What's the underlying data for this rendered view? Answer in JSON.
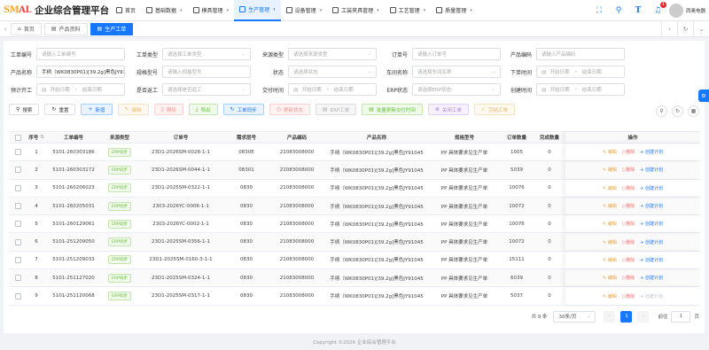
{
  "app": {
    "logo_mark_a": "SM",
    "logo_mark_b": "AL",
    "title": "企业综合管理平台"
  },
  "nav": [
    {
      "label": "首页",
      "icon": "home-icon",
      "chevron": false,
      "active": false
    },
    {
      "label": "基础数据",
      "icon": "grid-icon",
      "chevron": true,
      "active": false
    },
    {
      "label": "模具管理",
      "icon": "mold-icon",
      "chevron": true,
      "active": false
    },
    {
      "label": "生产管理",
      "icon": "factory-icon",
      "chevron": true,
      "active": true
    },
    {
      "label": "设备管理",
      "icon": "device-icon",
      "chevron": true,
      "active": false
    },
    {
      "label": "工装夹具管理",
      "icon": "tool-icon",
      "chevron": true,
      "active": false
    },
    {
      "label": "工艺管理",
      "icon": "process-icon",
      "chevron": true,
      "active": false
    },
    {
      "label": "质量管理",
      "icon": "quality-icon",
      "chevron": true,
      "active": false
    }
  ],
  "top_right": {
    "notification_count": "1",
    "username": "西奥电器"
  },
  "tabs": [
    {
      "label": "首页",
      "active": false
    },
    {
      "label": "产品资料",
      "active": false
    },
    {
      "label": "生产工单",
      "active": true
    }
  ],
  "filters": {
    "work_order_no": {
      "label": "工单编号",
      "placeholder": "请输入工单编号"
    },
    "work_order_type": {
      "label": "工单类型",
      "placeholder": "请选择工单类型"
    },
    "source_type": {
      "label": "来源类型",
      "placeholder": "请选择来源类型"
    },
    "order_no": {
      "label": "订单号",
      "placeholder": "请输入订单号"
    },
    "product_code": {
      "label": "产品编码",
      "placeholder": "请输入产品编码"
    },
    "product_name": {
      "label": "产品名称",
      "value": "手柄（WK0830P01)[39.2g]黑色JY91"
    },
    "spec_model": {
      "label": "规格型号",
      "placeholder": "请输入规格型号"
    },
    "status": {
      "label": "状态",
      "placeholder": "请选择状态"
    },
    "workshop_name": {
      "label": "车间名称",
      "placeholder": "请选择车间名称"
    },
    "order_time": {
      "label": "下单时间",
      "start": "开始日期",
      "end": "结束日期"
    },
    "planned_start": {
      "label": "预计开工",
      "start": "开始日期",
      "end": "结束日期"
    },
    "is_outsourced": {
      "label": "是否返工",
      "placeholder": "请选择是否返工"
    },
    "delivery_time": {
      "label": "交付时间",
      "start": "开始日期",
      "end": "结束日期"
    },
    "erp_status": {
      "label": "ERP状态",
      "placeholder": "请选择ERP状态"
    },
    "create_time": {
      "label": "创建时间",
      "start": "开始日期",
      "end": "结束日期"
    }
  },
  "toolbar": {
    "search": "搜索",
    "reset": "重置",
    "add": "新增",
    "edit": "编辑",
    "delete": "删除",
    "export": "导出",
    "sync": "工单同步",
    "deliver": "更新状态",
    "erp": "ERP工单",
    "batch_update": "批量更新交付时间",
    "close": "关闭工单",
    "finish": "完结工单"
  },
  "table": {
    "headers": [
      "序号",
      "工单编号",
      "来源类型",
      "订单号",
      "需求层号",
      "产品编码",
      "产品名称",
      "规格型号",
      "订单数量",
      "完成数量",
      "操作"
    ],
    "sort_icon": "⇅",
    "op_edit": "编辑",
    "op_delete": "删除",
    "op_plan": "+ 创建计划",
    "rows": [
      {
        "no": "1",
        "code": "5101-260303186",
        "source": "ERP同步",
        "order": "23D1-2026SM-0028-1-1",
        "req": "0830E",
        "pcode": "21083008000",
        "pname": "手柄（WK0830P01)[39.2g]黑色JY91045",
        "spec": "PP 具体要求见生产单",
        "qty": "1005",
        "done": "0",
        "plan_disabled": false
      },
      {
        "no": "2",
        "code": "5101-260303172",
        "source": "ERP同步",
        "order": "23D1-2026SM-0044-1-1",
        "req": "08301",
        "pcode": "21083008000",
        "pname": "手柄（WK0830P01)[39.2g]黑色JY91045",
        "spec": "PP 具体要求见生产单",
        "qty": "5039",
        "done": "0",
        "plan_disabled": false
      },
      {
        "no": "3",
        "code": "5101-260206023",
        "source": "ERP同步",
        "order": "23D1-2025SM-0322-1-1",
        "req": "0830",
        "pcode": "21083008000",
        "pname": "手柄（WK0830P01)[39.2g]黑色JY91045",
        "spec": "PP 具体要求见生产单",
        "qty": "10076",
        "done": "0",
        "plan_disabled": false
      },
      {
        "no": "4",
        "code": "5101-260205031",
        "source": "ERP同步",
        "order": "2303-2026YC-0006-1-1",
        "req": "0830",
        "pcode": "21083008000",
        "pname": "手柄（WK0830P01)[39.2g]黑色JY91045",
        "spec": "PP 具体要求见生产单",
        "qty": "10072",
        "done": "0",
        "plan_disabled": false
      },
      {
        "no": "5",
        "code": "5101-260129061",
        "source": "ERP同步",
        "order": "2303-2026YC-0002-1-1",
        "req": "0830",
        "pcode": "21083008000",
        "pname": "手柄（WK0830P01)[39.2g]黑色JY91045",
        "spec": "PP 具体要求见生产单",
        "qty": "10076",
        "done": "0",
        "plan_disabled": false
      },
      {
        "no": "6",
        "code": "5101-251209050",
        "source": "ERP同步",
        "order": "23D1-2025SM-0356-1-1",
        "req": "0830",
        "pcode": "21083008000",
        "pname": "手柄（WK0830P01)[39.2g]黑色JY91045",
        "spec": "PP 具体要求见生产单",
        "qty": "10072",
        "done": "0",
        "plan_disabled": false
      },
      {
        "no": "7",
        "code": "5101-251209033",
        "source": "ERP同步",
        "order": "23D1-2025SM-0160-3-1-1",
        "req": "0830",
        "pcode": "21083008000",
        "pname": "手柄（WK0830P01)[39.2g]黑色JY91045",
        "spec": "PP 具体要求见生产单",
        "qty": "15111",
        "done": "0",
        "plan_disabled": false
      },
      {
        "no": "8",
        "code": "5101-251127020",
        "source": "ERP同步",
        "order": "23D1-2025SM-0324-1-1",
        "req": "0830",
        "pcode": "21083008000",
        "pname": "手柄（WK0830P01)[39.2g]黑色JY91045",
        "spec": "PP 具体要求见生产单",
        "qty": "6039",
        "done": "0",
        "plan_disabled": false
      },
      {
        "no": "9",
        "code": "5101-251120068",
        "source": "ERP同步",
        "order": "23D1-2025SM-0317-1-1",
        "req": "0830",
        "pcode": "21083008000",
        "pname": "手柄（WK0830P01)[39.2g]黑色JY91045",
        "spec": "PP 具体要求见生产单",
        "qty": "5037",
        "done": "0",
        "plan_disabled": true
      }
    ]
  },
  "pager": {
    "total": "共 9 条",
    "page_size": "30条/页",
    "current": "1",
    "goto_label": "前往",
    "goto_value": "1",
    "page_suffix": "页"
  },
  "footer": "Copyright ©2026 企业综合管理平台",
  "colors": {
    "primary": "#1677ff",
    "success": "#67c23a",
    "warning": "#e6a23c",
    "danger": "#f56c6c"
  }
}
